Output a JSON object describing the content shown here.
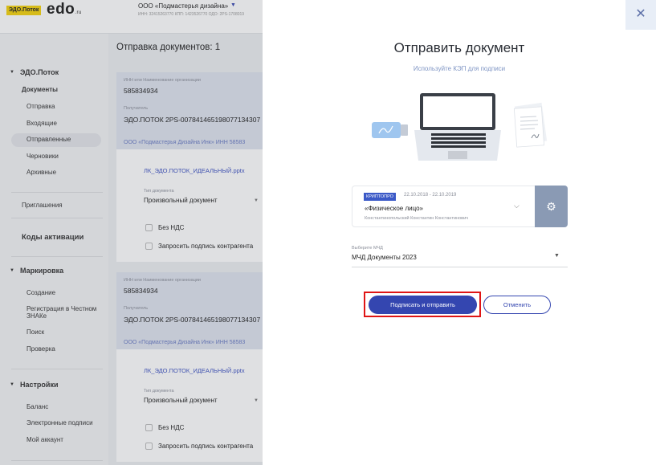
{
  "header": {
    "logo_badge": "ЭДО.Поток",
    "logo_brand": "edo",
    "logo_suffix": ".ru",
    "org_name": "ООО «Подмастерья дизайна»",
    "org_meta": "ИНН: 32415263770 КПП: 1423526770 ОДО: 2PS-1708019"
  },
  "sidebar": {
    "group1": "ЭДО.Поток",
    "documents": "Документы",
    "items": [
      "Отправка",
      "Входящие",
      "Отправленные",
      "Черновики",
      "Архивные"
    ],
    "invitations": "Приглашения",
    "activation_codes": "Коды активации",
    "group2": "Маркировка",
    "marking_items": [
      "Создание",
      "Регистрация в Честном ЗНАКе",
      "Поиск",
      "Проверка"
    ],
    "group3": "Настройки",
    "settings_items": [
      "Баланс",
      "Электронные подписи",
      "Мой аккаунт"
    ]
  },
  "main": {
    "title": "Отправка документов: 1",
    "cards": [
      {
        "inn_label": "ИНН или Наименование организации",
        "inn_value": "585834934",
        "recipient_label": "Получатель",
        "recipient_value": "ЭДО.ПОТОК 2PS-007841465198077134307",
        "org_line": "ООО «Подмастерья Дизайна Инк»   ИНН 58583",
        "file": "ЛК_ЭДО.ПОТОК_ИДЕАЛЬНЫЙ.pptx",
        "doctype_label": "Тип документа",
        "doctype_value": "Произвольный документ",
        "chk_vat": "Без НДС",
        "chk_sign": "Запросить подпись контрагента"
      },
      {
        "inn_label": "ИНН или Наименование организации",
        "inn_value": "585834934",
        "recipient_label": "Получатель",
        "recipient_value": "ЭДО.ПОТОК 2PS-007841465198077134307",
        "org_line": "ООО «Подмастерья Дизайна Инк»   ИНН 58583",
        "file": "ЛК_ЭДО.ПОТОК_ИДЕАЛЬНЫЙ.pptx",
        "doctype_label": "Тип документа",
        "doctype_value": "Произвольный документ",
        "chk_vat": "Без НДС",
        "chk_sign": "Запросить подпись контрагента"
      }
    ]
  },
  "modal": {
    "close_icon": "close-icon",
    "title": "Отправить документ",
    "subtitle": "Используйте КЭП для подписи",
    "cert": {
      "badge": "КРИПТОПРО",
      "dates": "22.10.2018 - 22.10.2019",
      "name": "«Физическое лицо»",
      "owner": "Константинопольский Константин Константинович"
    },
    "mchd": {
      "label": "Выберите МЧД",
      "value": "МЧД Документы 2023"
    },
    "buttons": {
      "primary": "Подписать и отправить",
      "cancel": "Отменить"
    },
    "colors": {
      "accent": "#3446b0",
      "highlight": "#e01515",
      "badge": "#3b59c7"
    }
  }
}
